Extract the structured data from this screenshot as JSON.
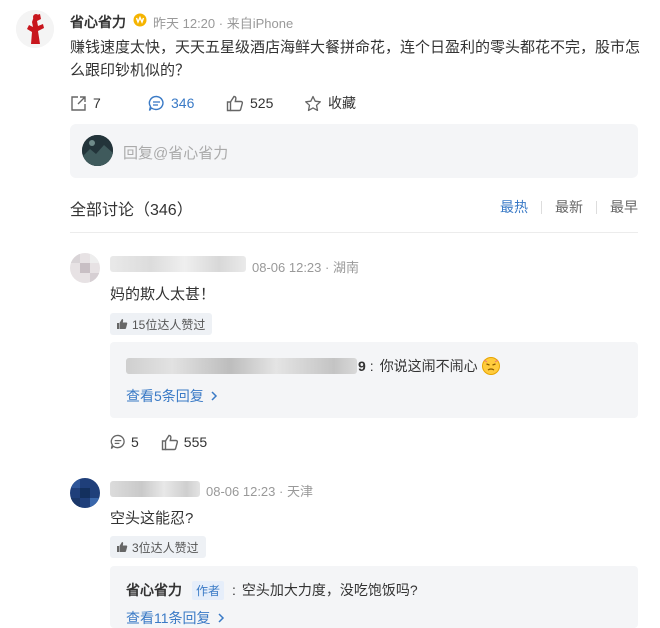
{
  "post": {
    "username": "省心省力",
    "time": "昨天 12:20",
    "source": "来自iPhone",
    "text": "赚钱速度太快，天天五星级酒店海鲜大餐拼命花，连个日盈利的零头都花不完，股市怎么跟印钞机似的？",
    "repost_count": "7",
    "comment_count": "346",
    "like_count": "525",
    "favorite_label": "收藏",
    "reply_placeholder": "回复@省心省力"
  },
  "discussion": {
    "title": "全部讨论（346）",
    "sorts": [
      "最热",
      "最新",
      "最早"
    ],
    "active_sort": "最热"
  },
  "comments": [
    {
      "name_fragment": "...达",
      "date": "08-06 12:23",
      "location": "湖南",
      "text": "妈的欺人太甚！",
      "likes": "15位达人赞过",
      "sub_reply_name_tail": "9",
      "sub_reply_text": "你说这闹不闹心",
      "more_replies": "查看5条回复",
      "comment_count": "5",
      "like_count": "555"
    },
    {
      "date": "08-06 12:23",
      "location": "天津",
      "text": "空头这能忍?",
      "likes": "3位达人赞过",
      "sub_reply_name": "省心省力",
      "author_tag": "作者",
      "sub_reply_text": "空头加大力度，没吃饱饭吗?",
      "more_replies": "查看11条回复"
    }
  ],
  "colors": {
    "accent": "#3a7ac6",
    "muted": "#999999",
    "panel": "#f4f5f7"
  }
}
